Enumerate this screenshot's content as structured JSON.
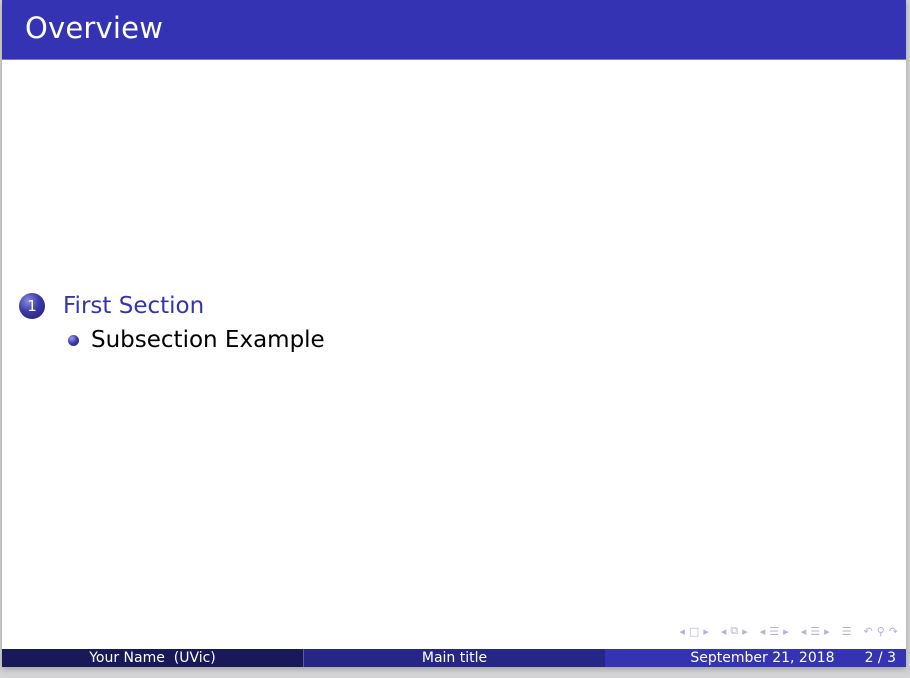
{
  "frame": {
    "title": "Overview"
  },
  "toc": {
    "sections": [
      {
        "number": "1",
        "label": "First Section",
        "subsections": [
          "Subsection Example"
        ]
      }
    ]
  },
  "navigation": {
    "icons": [
      "frame-nav-icon",
      "subsection-nav-icon",
      "section-nav-icon",
      "section-nav-icon",
      "doc-nav-icon",
      "back-icon",
      "search-icon",
      "forward-icon"
    ]
  },
  "footline": {
    "author": "Your Name  (UVic)",
    "title": "Main title",
    "date": "September 21, 2018",
    "page": "2 / 3"
  },
  "colors": {
    "structure": "#3333b3",
    "footer_dark": "#191959",
    "footer_mid": "#262686"
  }
}
